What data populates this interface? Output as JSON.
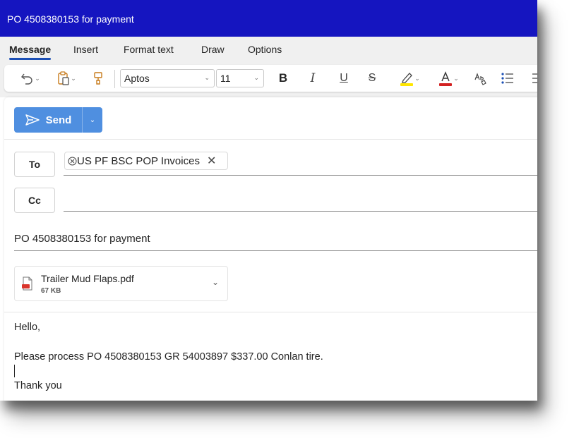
{
  "window": {
    "title": "PO 4508380153 for payment"
  },
  "tabs": [
    {
      "label": "Message",
      "active": true
    },
    {
      "label": "Insert"
    },
    {
      "label": "Format text"
    },
    {
      "label": "Draw"
    },
    {
      "label": "Options"
    }
  ],
  "ribbon": {
    "font_name": "Aptos",
    "font_size": "11",
    "bold": "B",
    "italic": "I",
    "underline": "U",
    "strikethrough": "S",
    "highlight_color": "#ffe600",
    "font_color": "#d32222"
  },
  "compose": {
    "send_label": "Send",
    "to_label": "To",
    "cc_label": "Cc",
    "to_recipients": [
      {
        "name": "US PF BSC POP Invoices"
      }
    ],
    "subject": "PO 4508380153 for payment",
    "attachment": {
      "name": "Trailer Mud Flaps.pdf",
      "size": "67 KB"
    },
    "body_lines": [
      "Hello,",
      "",
      "Please process PO 4508380153 GR 54003897 $337.00 Conlan tire.",
      "",
      "Thank you"
    ]
  },
  "colors": {
    "title_bar": "#1515c0",
    "accent": "#1b4fb5",
    "send_button": "#4f8fe0"
  }
}
